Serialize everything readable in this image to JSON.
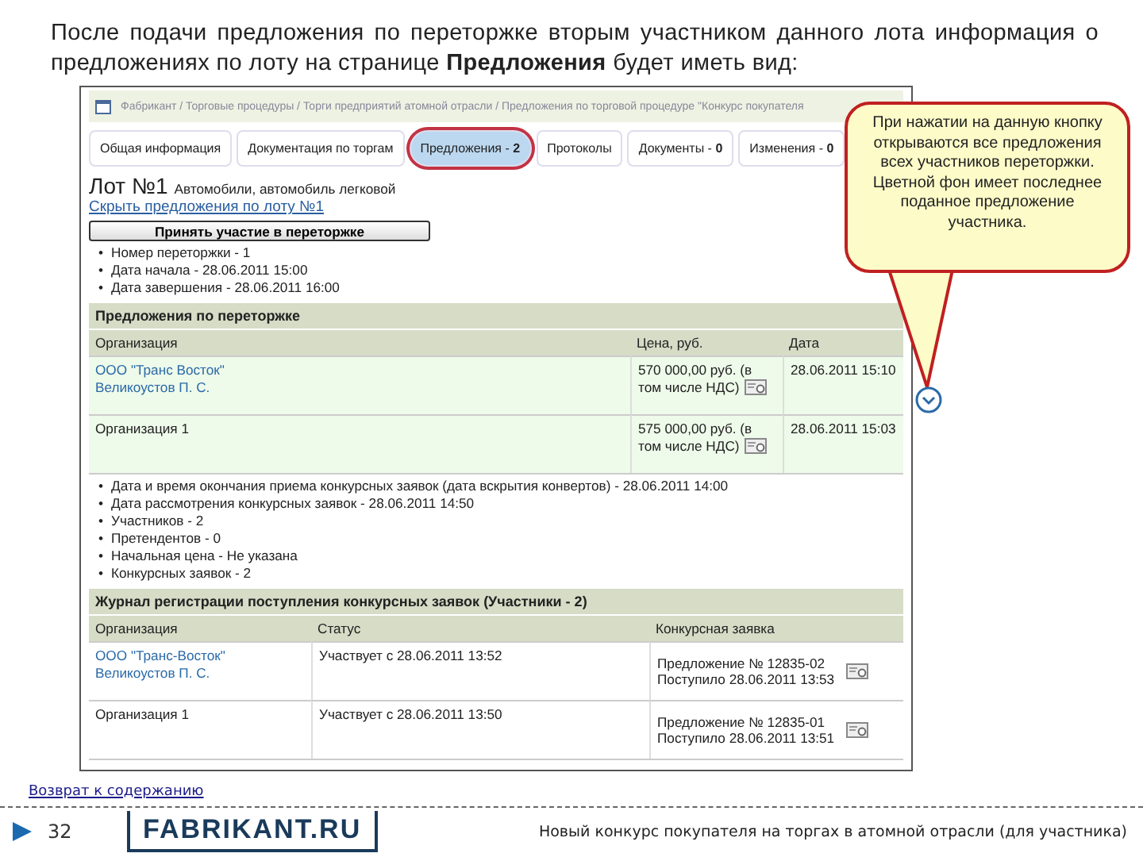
{
  "intro": "После подачи предложения по переторжке вторым участником данного лота информация о предложениях по лоту на странице **Предложения** будет иметь вид:",
  "breadcrumb": "Фабрикант / Торговые процедуры / Торги предприятий атомной отрасли / Предложения по торговой процедуре \"Конкурс покупателя",
  "bullet": "•",
  "tabs": [
    {
      "label": "Общая информация",
      "selected": false
    },
    {
      "label": "Документация по торгам",
      "selected": false
    },
    {
      "label": "Предложения - **2**",
      "selected": true
    },
    {
      "label": "Протоколы",
      "selected": false
    },
    {
      "label": "Документы - **0**",
      "selected": false
    },
    {
      "label": "Изменения - **0**",
      "selected": false
    }
  ],
  "lot": {
    "number": "Лот №1",
    "name": "Автомобили, автомобиль легковой",
    "hide_link": "Скрыть предложения по лоту №1",
    "action_button": "Принять участие в переторжке"
  },
  "retrade_facts": [
    "Номер переторжки - 1",
    "Дата начала - 28.06.2011 15:00",
    "Дата завершения - 28.06.2011 16:00"
  ],
  "offers": {
    "title": "Предложения по переторжке",
    "columns": [
      "Организация",
      "Цена, руб.",
      "Дата"
    ],
    "rows": [
      {
        "organization": "ООО \"Транс Восток\"",
        "contact": "Великоустов П. С.",
        "link": true,
        "highlighted": true,
        "price": "570 000,00 руб. (в том числе НДС)",
        "date": "28.06.2011 15:10"
      },
      {
        "organization": "Организация 1",
        "link": false,
        "highlighted": true,
        "price": "575 000,00 руб. (в том числе НДС)",
        "date": "28.06.2011 15:03"
      }
    ]
  },
  "lot_facts": [
    "Дата и время окончания приема конкурсных заявок (дата вскрытия конвертов) - 28.06.2011 14:00",
    "Дата рассмотрения конкурсных заявок - 28.06.2011 14:50",
    "Участников - 2",
    "Претендентов - 0",
    "Начальная цена - Не указана",
    "Конкурсных заявок - 2"
  ],
  "journal": {
    "title": "Журнал регистрации поступления конкурсных заявок (Участники - 2)",
    "columns": [
      "Организация",
      "Статус",
      "Конкурсная заявка"
    ],
    "rows": [
      {
        "organization": "ООО \"Транс-Восток\"",
        "contact": "Великоустов П. С.",
        "link": true,
        "status": "Участвует с 28.06.2011 13:52",
        "offer": "Предложение № 12835-02",
        "received": "Поступило 28.06.2011 13:53"
      },
      {
        "organization": "Организация 1",
        "link": false,
        "status": "Участвует с 28.06.2011 13:50",
        "offer": "Предложение № 12835-01",
        "received": "Поступило 28.06.2011 13:51"
      }
    ]
  },
  "callout": "При нажатии на данную кнопку открываются все предложения всех участников переторжки. Цветной фон имеет последнее поданное предложение участника.",
  "footer": {
    "back_link": "Возврат к содержанию",
    "page": "32",
    "logo": "FABRIKANT.RU",
    "caption": "Новый конкурс покупателя на торгах в атомной отрасли (для участника)"
  }
}
